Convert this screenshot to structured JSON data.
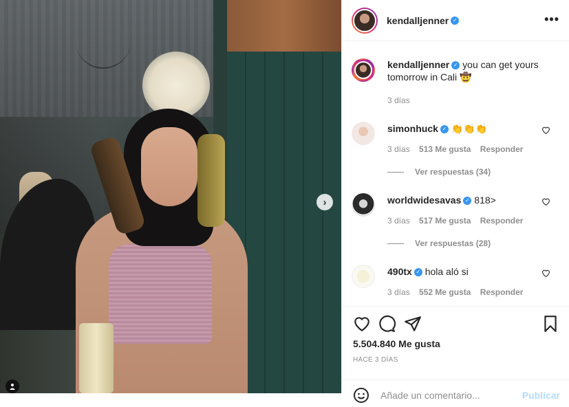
{
  "post": {
    "author": "kendalljenner",
    "verified": true,
    "more_label": "•••",
    "next_label": "›"
  },
  "caption": {
    "username": "kendalljenner",
    "text": "you can get yours tomorrow in Cali",
    "emoji": "🤠",
    "time": "3 días"
  },
  "comments": [
    {
      "username": "simonhuck",
      "text": "👏👏👏",
      "time": "3 días",
      "likes": "513 Me gusta",
      "reply": "Responder",
      "replies": "Ver respuestas (34)"
    },
    {
      "username": "worldwidesavas",
      "text": "818>",
      "time": "3 días",
      "likes": "517 Me gusta",
      "reply": "Responder",
      "replies": "Ver respuestas (28)"
    },
    {
      "username": "490tx",
      "text": "hola aló si",
      "time": "3 días",
      "likes": "552 Me gusta",
      "reply": "Responder"
    }
  ],
  "actions": {
    "likes": "5.504.840 Me gusta",
    "posted": "HACE 3 DÍAS"
  },
  "add_comment": {
    "placeholder": "Añade un comentario...",
    "publish": "Publicar"
  },
  "icons": {
    "like": "heart-outline",
    "comment": "speech-bubble",
    "share": "paper-plane",
    "save": "bookmark",
    "emoji": "smiley"
  },
  "colors": {
    "verified": "#3897f0",
    "publish_disabled": "#b3dbff",
    "muted": "#8e8e8e",
    "text": "#262626"
  }
}
